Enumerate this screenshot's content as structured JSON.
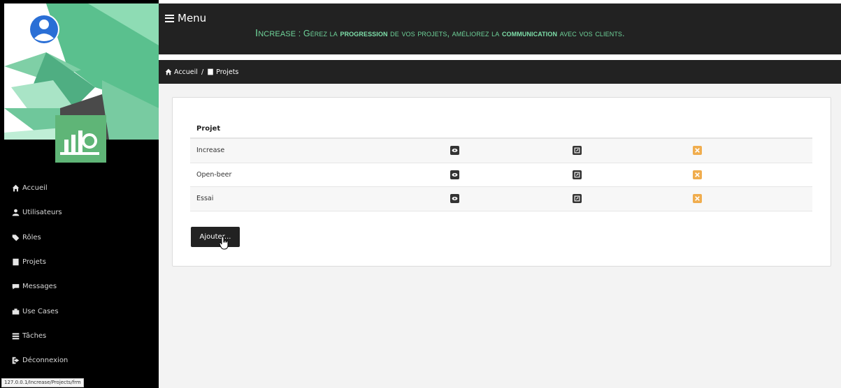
{
  "header": {
    "menu_label": "Menu",
    "tagline": {
      "brand": "Increase",
      "sep": " : ",
      "p1": "Gérez la ",
      "b1": "progression",
      "p2": " de vos projets, améliorez la ",
      "b2": "communication",
      "p3": " avec vos clients."
    }
  },
  "breadcrumb": [
    {
      "label": "Accueil",
      "icon": "home-icon"
    },
    {
      "label": "Projets",
      "icon": "book-icon"
    }
  ],
  "breadcrumb_sep": "/",
  "sidebar": {
    "items": [
      {
        "label": "Accueil",
        "icon": "home-icon"
      },
      {
        "label": "Utilisateurs",
        "icon": "user-icon"
      },
      {
        "label": "Rôles",
        "icon": "tag-icon"
      },
      {
        "label": "Projets",
        "icon": "book-icon"
      },
      {
        "label": "Messages",
        "icon": "comment-icon"
      },
      {
        "label": "Use Cases",
        "icon": "briefcase-icon"
      },
      {
        "label": "Tâches",
        "icon": "tasks-icon"
      },
      {
        "label": "Déconnexion",
        "icon": "logout-icon"
      }
    ]
  },
  "table": {
    "header": "Projet",
    "rows": [
      {
        "name": "Increase"
      },
      {
        "name": "Open-beer"
      },
      {
        "name": "Essai"
      }
    ]
  },
  "add_button_label": "Ajouter...",
  "status_url": "127.0.0.1/Increase/Projects/frm",
  "colors": {
    "accent_green": "#6fd49a",
    "dark": "#222222",
    "delete_orange": "#f0ad4e"
  }
}
